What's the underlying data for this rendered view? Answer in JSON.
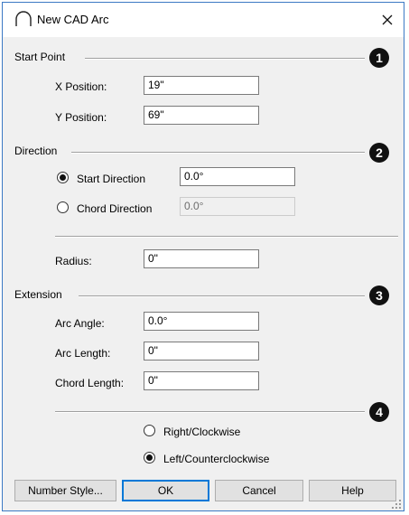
{
  "window": {
    "title": "New CAD Arc"
  },
  "callouts": [
    "1",
    "2",
    "3",
    "4"
  ],
  "start_point": {
    "heading": "Start Point",
    "x_label": "X Position:",
    "x_value": "19\"",
    "y_label": "Y Position:",
    "y_value": "69\""
  },
  "direction": {
    "heading": "Direction",
    "start_label": "Start Direction",
    "start_value": "0.0°",
    "start_selected": true,
    "chord_label": "Chord Direction",
    "chord_value": "0.0°",
    "chord_selected": false
  },
  "radius": {
    "label": "Radius:",
    "value": "0\""
  },
  "extension": {
    "heading": "Extension",
    "angle_label": "Arc Angle:",
    "angle_value": "0.0°",
    "length_label": "Arc Length:",
    "length_value": "0\"",
    "chord_label": "Chord Length:",
    "chord_value": "0\""
  },
  "orientation": {
    "right_label": "Right/Clockwise",
    "right_selected": false,
    "left_label": "Left/Counterclockwise",
    "left_selected": true
  },
  "buttons": {
    "number_style": "Number Style...",
    "ok": "OK",
    "cancel": "Cancel",
    "help": "Help"
  }
}
